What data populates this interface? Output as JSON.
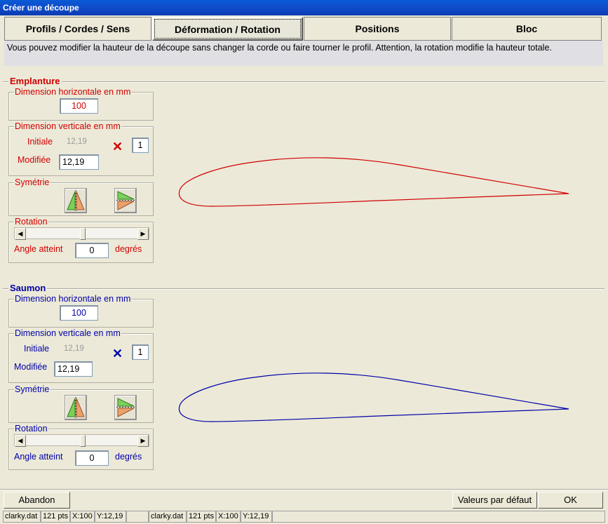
{
  "window": {
    "title": "Créer une découpe"
  },
  "tabs": [
    {
      "label": "Profils / Cordes / Sens"
    },
    {
      "label": "Déformation / Rotation"
    },
    {
      "label": "Positions"
    },
    {
      "label": "Bloc"
    }
  ],
  "info_text": "Vous pouvez modifier la hauteur de la découpe sans changer la corde ou faire tourner le profil. Attention, la rotation modifie la hauteur totale.",
  "root": {
    "title": "Emplanture",
    "horizontal": {
      "label": "Dimension horizontale en mm",
      "value": "100"
    },
    "vertical": {
      "label": "Dimension verticale en mm",
      "initial_label": "Initiale",
      "initial_value": "12,19",
      "modified_label": "Modifiée",
      "modified_value": "12,19",
      "multiplier": "1"
    },
    "symmetry": {
      "label": "Symétrie"
    },
    "rotation": {
      "label": "Rotation",
      "angle_label": "Angle atteint",
      "angle_value": "0",
      "angle_unit": "degrés",
      "slider_position": 0.5
    },
    "color": "#d00000"
  },
  "tip": {
    "title": "Saumon",
    "horizontal": {
      "label": "Dimension horizontale en mm",
      "value": "100"
    },
    "vertical": {
      "label": "Dimension verticale en mm",
      "initial_label": "Initiale",
      "initial_value": "12,19",
      "modified_label": "Modifiée",
      "modified_value": "12,19",
      "multiplier": "1"
    },
    "symmetry": {
      "label": "Symétrie"
    },
    "rotation": {
      "label": "Rotation",
      "angle_label": "Angle atteint",
      "angle_value": "0",
      "angle_unit": "degrés",
      "slider_position": 0.5
    },
    "color": "#0000a8"
  },
  "buttons": {
    "cancel": "Abandon",
    "defaults": "Valeurs par défaut",
    "ok": "OK"
  },
  "status": {
    "root_file": "clarky.dat",
    "root_pts": "121 pts",
    "root_x": "X:100",
    "root_y": "Y:12,19",
    "tip_file": "clarky.dat",
    "tip_pts": "121 pts",
    "tip_x": "X:100",
    "tip_y": "Y:12,19"
  }
}
